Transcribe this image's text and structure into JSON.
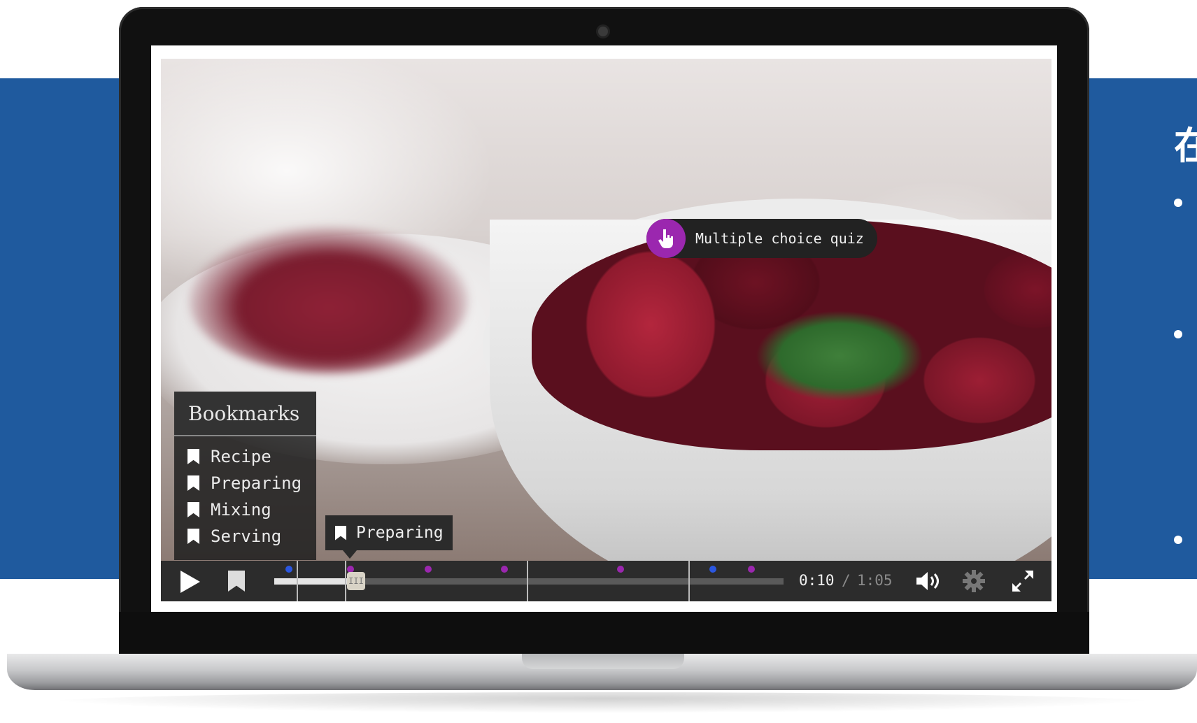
{
  "side_panel": {
    "title_fragment": "在",
    "bullets": [
      "",
      "",
      ""
    ]
  },
  "video": {
    "hotspot": {
      "label": "Multiple choice  quiz",
      "icon": "hand-pointer-icon",
      "color": "#9b27af"
    },
    "bookmarks_panel": {
      "title": "Bookmarks",
      "items": [
        {
          "label": "Recipe",
          "icon": "bookmark-icon"
        },
        {
          "label": "Preparing",
          "icon": "bookmark-icon"
        },
        {
          "label": "Mixing",
          "icon": "bookmark-icon"
        },
        {
          "label": "Serving",
          "icon": "bookmark-icon"
        }
      ]
    },
    "tooltip": {
      "label": "Preparing",
      "icon": "bookmark-icon"
    },
    "controls": {
      "play_icon": "play-icon",
      "bookmark_icon": "bookmark-icon",
      "current_time": "0:10",
      "separator": "/",
      "duration": "1:05",
      "progress_fraction": 0.154,
      "handle_glyph": "III",
      "volume_icon": "volume-icon",
      "settings_icon": "gear-icon",
      "fullscreen_icon": "fullscreen-icon",
      "marker_colors": {
        "blue": "#2b57e0",
        "purple": "#9b27af"
      }
    }
  },
  "colors": {
    "band_blue": "#1f5a9e"
  }
}
